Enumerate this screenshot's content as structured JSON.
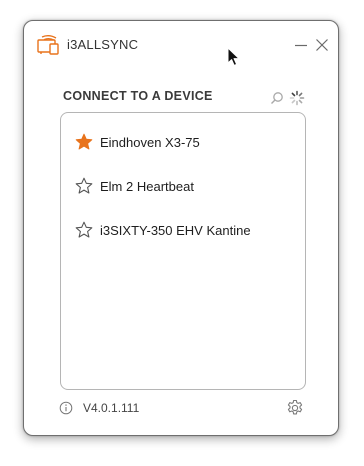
{
  "app": {
    "title": "i3ALLSYNC",
    "brand_color": "#e8731c"
  },
  "window_controls": {
    "minimize_icon": "minimize-icon",
    "close_icon": "close-icon"
  },
  "connect": {
    "title": "CONNECT TO A DEVICE",
    "search_icon": "search-icon",
    "status_icon": "loading-spinner-icon"
  },
  "devices": [
    {
      "name": "Eindhoven X3-75",
      "favorite": true
    },
    {
      "name": "Elm 2 Heartbeat",
      "favorite": false
    },
    {
      "name": "i3SIXTY-350 EHV Kantine",
      "favorite": false
    }
  ],
  "footer": {
    "info_icon": "info-icon",
    "version": "V4.0.1.111",
    "settings_icon": "gear-icon"
  },
  "colors": {
    "favorite_star": "#e8731c",
    "unfavorite_star": "#555555"
  }
}
